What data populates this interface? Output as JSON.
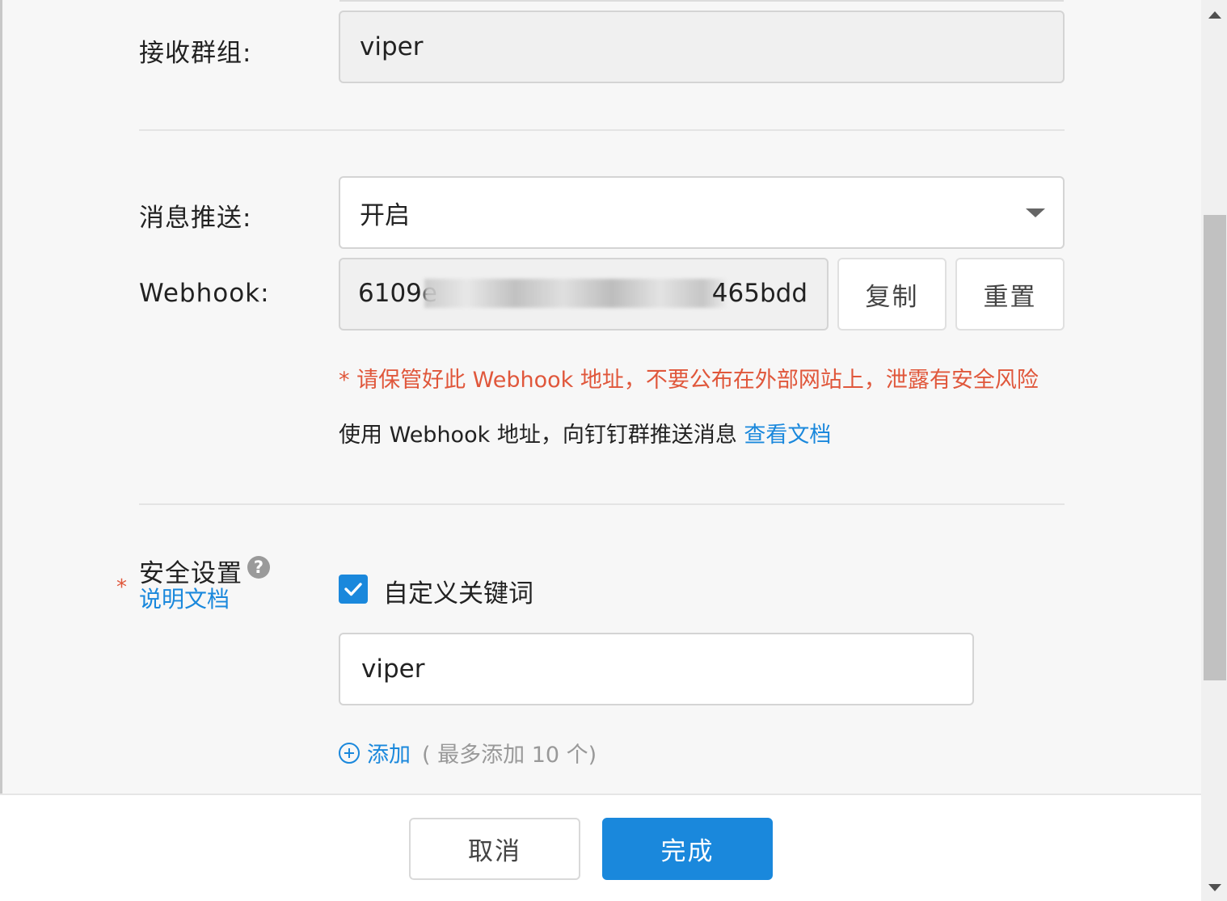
{
  "group": {
    "label": "接收群组:",
    "value": "viper"
  },
  "push": {
    "label": "消息推送:",
    "value": "开启"
  },
  "webhook": {
    "label": "Webhook:",
    "value_start": "6109e",
    "value_end": "465bdd",
    "copy_label": "复制",
    "reset_label": "重置",
    "warning": "* 请保管好此 Webhook 地址，不要公布在外部网站上，泄露有安全风险",
    "info": "使用 Webhook 地址，向钉钉群推送消息 ",
    "doc_link": "查看文档"
  },
  "security": {
    "required_mark": "*",
    "label": "安全设置",
    "help_icon": "?",
    "doc_link": "说明文档",
    "keyword_checkbox_label": "自定义关键词",
    "keyword_checked": true,
    "keyword_value": "viper",
    "add_label": "添加",
    "add_hint": "( 最多添加 10 个)"
  },
  "footer": {
    "cancel_label": "取消",
    "done_label": "完成"
  },
  "colors": {
    "primary": "#1a88dc",
    "warning": "#e0573b",
    "background": "#f7f7f7"
  },
  "icons": [
    "chevron-down-icon",
    "help-icon",
    "check-icon",
    "plus-circle-icon",
    "scroll-up-icon",
    "scroll-down-icon"
  ]
}
